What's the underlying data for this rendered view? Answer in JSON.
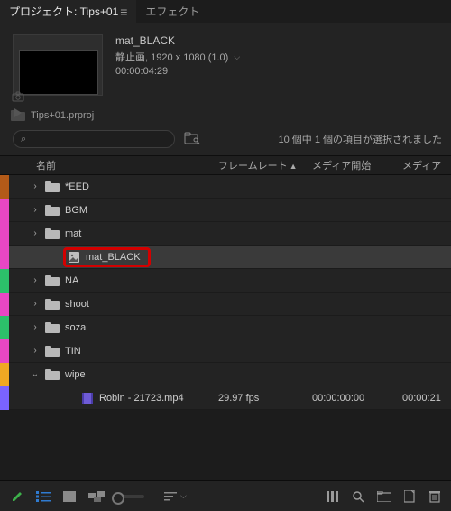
{
  "tabs": {
    "project": "プロジェクト: Tips+01",
    "effects": "エフェクト"
  },
  "selected_clip": {
    "name": "mat_BLACK",
    "type": "静止画, 1920 x 1080 (1.0)",
    "duration": "00:00:04:29"
  },
  "project_file": "Tips+01.prproj",
  "status_text": "10 個中 1 個の項目が選択されました",
  "columns": {
    "name": "名前",
    "framerate": "フレームレート",
    "media_start": "メディア開始",
    "media_end": "メディア"
  },
  "rows": [
    {
      "swatch": "#b35a18",
      "indent": 0,
      "twisty": ">",
      "type": "folder",
      "label": "*EED"
    },
    {
      "swatch": "#e847c4",
      "indent": 0,
      "twisty": ">",
      "type": "folder",
      "label": "BGM"
    },
    {
      "swatch": "#e847c4",
      "indent": 0,
      "twisty": ">",
      "type": "folder",
      "label": "mat"
    },
    {
      "swatch": "#e847c4",
      "indent": 1,
      "twisty": "",
      "type": "item",
      "label": "mat_BLACK",
      "selected": true,
      "boxed": true
    },
    {
      "swatch": "#2cc06a",
      "indent": 0,
      "twisty": ">",
      "type": "folder",
      "label": "NA"
    },
    {
      "swatch": "#e847c4",
      "indent": 0,
      "twisty": ">",
      "type": "folder",
      "label": "shoot"
    },
    {
      "swatch": "#2cc06a",
      "indent": 0,
      "twisty": ">",
      "type": "folder",
      "label": "sozai"
    },
    {
      "swatch": "#e847c4",
      "indent": 0,
      "twisty": ">",
      "type": "folder",
      "label": "TIN"
    },
    {
      "swatch": "#f0a823",
      "indent": 0,
      "twisty": "v",
      "type": "folder",
      "label": "wipe"
    },
    {
      "swatch": "#7a63ff",
      "indent": 2,
      "twisty": "",
      "type": "clip",
      "label": "Robin - 21723.mp4",
      "rate": "29.97 fps",
      "start": "00:00:00:00",
      "end": "00:00:21"
    }
  ]
}
